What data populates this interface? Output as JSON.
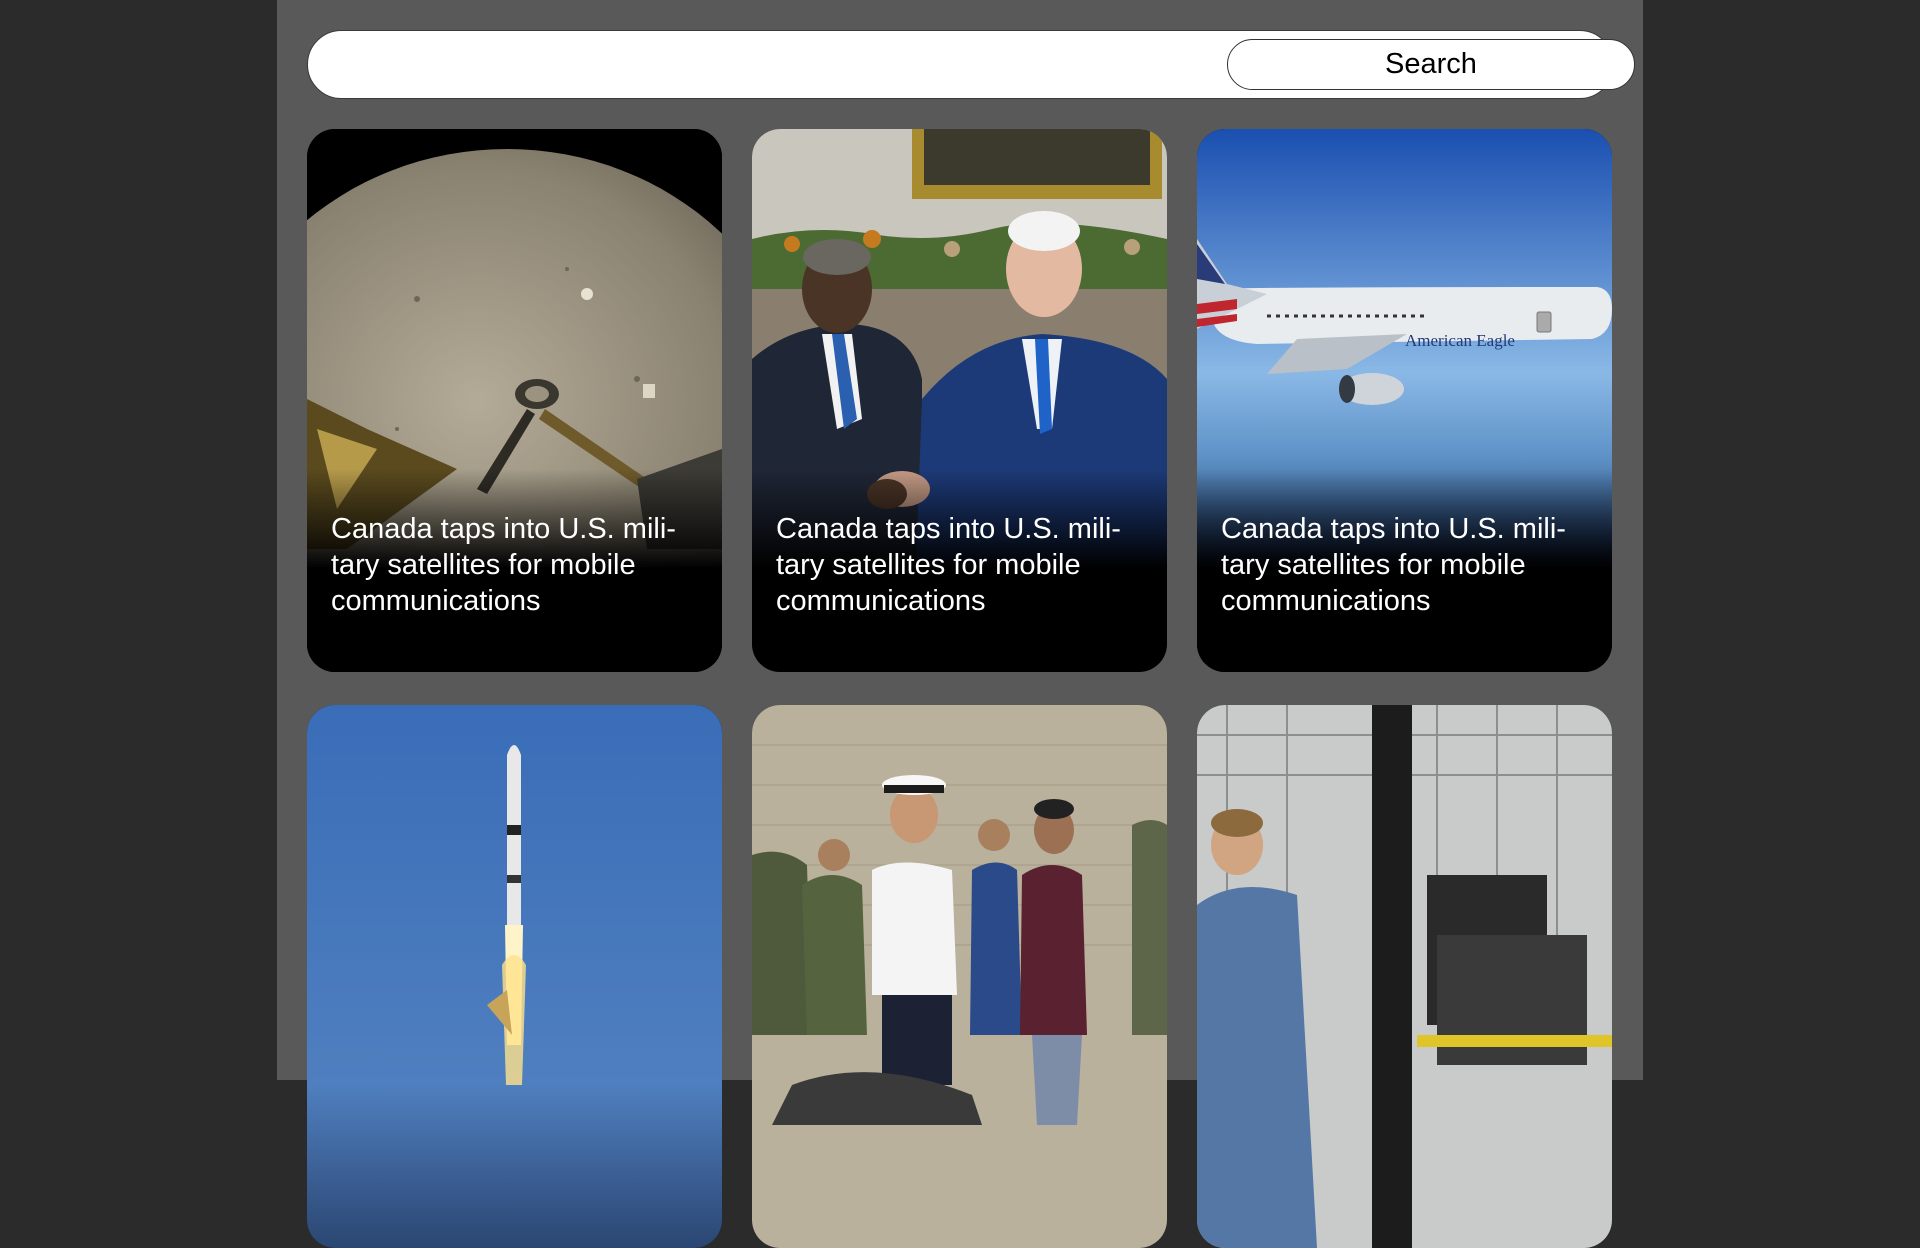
{
  "search": {
    "value": "",
    "placeholder": "",
    "button_label": "Search"
  },
  "articles": [
    {
      "title": "Canada taps into U.S. mili-tary satellites for mobile communications",
      "image": "lunar-surface-lander-photo"
    },
    {
      "title": "Canada taps into U.S. mili-tary satellites for mobile communications",
      "image": "leaders-handshake-photo"
    },
    {
      "title": "Canada taps into U.S. mili-tary satellites for mobile communications",
      "image": "american-eagle-jet-photo",
      "image_text": "American Eagle"
    },
    {
      "title": "",
      "image": "rocket-launch-photo"
    },
    {
      "title": "",
      "image": "naval-officer-group-photo"
    },
    {
      "title": "",
      "image": "factory-worker-photo"
    }
  ]
}
